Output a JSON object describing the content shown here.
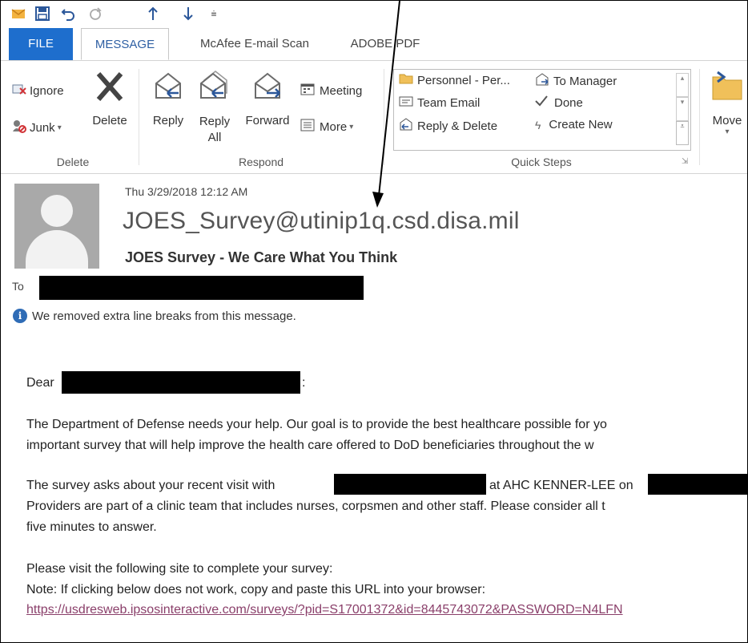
{
  "qat": {
    "icons": [
      "mail-icon",
      "save-icon",
      "undo-icon",
      "redo-icon",
      "up-arrow-icon",
      "down-arrow-icon",
      "customize-icon"
    ]
  },
  "tabs": [
    "FILE",
    "MESSAGE",
    "McAfee E-mail Scan",
    "ADOBE PDF"
  ],
  "ribbon": {
    "delete_group": {
      "ignore": "Ignore",
      "junk": "Junk",
      "delete": "Delete",
      "label": "Delete"
    },
    "respond_group": {
      "reply": "Reply",
      "reply_all_1": "Reply",
      "reply_all_2": "All",
      "forward": "Forward",
      "meeting": "Meeting",
      "more": "More",
      "label": "Respond"
    },
    "quick_steps": {
      "items": [
        "Personnel - Per...",
        "To Manager",
        "Team Email",
        "Done",
        "Reply & Delete",
        "Create New"
      ],
      "label": "Quick Steps"
    },
    "move": {
      "label": "Move"
    }
  },
  "message": {
    "date": "Thu 3/29/2018 12:12 AM",
    "sender": "JOES_Survey@utinip1q.csd.disa.mil",
    "subject": "JOES Survey - We Care What You Think",
    "to_label": "To",
    "info": "We removed extra line breaks from this message."
  },
  "body": {
    "greeting": "Dear",
    "greeting_colon": ":",
    "p1_line1": "The Department of Defense needs your help.  Our goal is to provide the best healthcare possible for yo",
    "p1_line2": "important survey that will help improve the health care offered to DoD beneficiaries throughout the w",
    "p2_line1_a": "The survey asks about your recent visit with",
    "p2_line1_b": "at AHC KENNER-LEE on",
    "p2_line2": "Providers are part of a clinic team that includes nurses, corpsmen and other staff. Please consider all t",
    "p2_line3": "five minutes to answer.",
    "p3_line1": "Please visit the following site to complete your survey:",
    "p3_line2": "Note: If clicking below does not work, copy and paste this URL into your browser:",
    "url": "https://usdresweb.ipsosinteractive.com/surveys/?pid=S17001372&id=8445743072&PASSWORD=N4LFN"
  }
}
